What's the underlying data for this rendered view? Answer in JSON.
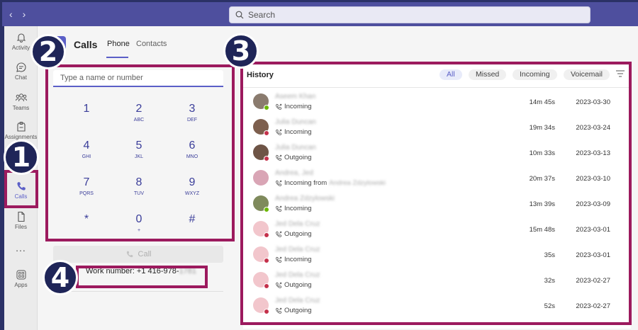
{
  "titlebar": {
    "search_placeholder": "Search"
  },
  "rail": {
    "items": [
      {
        "label": "Activity",
        "icon": "bell-icon"
      },
      {
        "label": "Chat",
        "icon": "chat-icon"
      },
      {
        "label": "Teams",
        "icon": "teams-icon"
      },
      {
        "label": "Assignments",
        "icon": "assignments-icon"
      },
      {
        "label": "Calls",
        "icon": "phone-icon"
      },
      {
        "label": "Files",
        "icon": "file-icon"
      },
      {
        "label": "...",
        "icon": "more-icon"
      },
      {
        "label": "Apps",
        "icon": "apps-icon"
      }
    ]
  },
  "header": {
    "title": "Calls",
    "tabs": [
      "Phone",
      "Contacts"
    ]
  },
  "dialpad": {
    "placeholder": "Type a name or number",
    "keys": [
      {
        "d": "1",
        "l": ""
      },
      {
        "d": "2",
        "l": "ABC"
      },
      {
        "d": "3",
        "l": "DEF"
      },
      {
        "d": "4",
        "l": "GHI"
      },
      {
        "d": "5",
        "l": "JKL"
      },
      {
        "d": "6",
        "l": "MNO"
      },
      {
        "d": "7",
        "l": "PQRS"
      },
      {
        "d": "8",
        "l": "TUV"
      },
      {
        "d": "9",
        "l": "WXYZ"
      },
      {
        "d": "*",
        "l": ""
      },
      {
        "d": "0",
        "l": "+"
      },
      {
        "d": "#",
        "l": ""
      }
    ],
    "call_label": "Call",
    "work_number_label": "Work number: +1 416-978-",
    "work_number_suffix": "1781"
  },
  "history": {
    "title": "History",
    "filters": [
      "All",
      "Missed",
      "Incoming",
      "Voicemail"
    ],
    "active_filter": "All",
    "rows": [
      {
        "name": "Aseem Khan",
        "direction": "Incoming",
        "extra": "",
        "duration": "14m 45s",
        "date": "2023-03-30",
        "presence": "#6bb700"
      },
      {
        "name": "Julia Duncan",
        "direction": "Incoming",
        "extra": "",
        "duration": "19m 34s",
        "date": "2023-03-24",
        "presence": "#c4314b"
      },
      {
        "name": "Julia Duncan",
        "direction": "Outgoing",
        "extra": "",
        "duration": "10m 33s",
        "date": "2023-03-13",
        "presence": "#c4314b"
      },
      {
        "name": "Andrea, Jed",
        "direction": "Incoming from",
        "extra": "Andrea Zdzylowski",
        "duration": "20m 37s",
        "date": "2023-03-10",
        "presence": ""
      },
      {
        "name": "Andrea Zdzylowski",
        "direction": "Incoming",
        "extra": "",
        "duration": "13m 39s",
        "date": "2023-03-09",
        "presence": "#6bb700"
      },
      {
        "name": "Jed Dela Cruz",
        "direction": "Outgoing",
        "extra": "",
        "duration": "15m 48s",
        "date": "2023-03-01",
        "presence": "#c4314b"
      },
      {
        "name": "Jed Dela Cruz",
        "direction": "Incoming",
        "extra": "",
        "duration": "35s",
        "date": "2023-03-01",
        "presence": "#c4314b"
      },
      {
        "name": "Jed Dela Cruz",
        "direction": "Outgoing",
        "extra": "",
        "duration": "32s",
        "date": "2023-02-27",
        "presence": "#c4314b"
      },
      {
        "name": "Jed Dela Cruz",
        "direction": "Outgoing",
        "extra": "",
        "duration": "52s",
        "date": "2023-02-27",
        "presence": "#c4314b"
      }
    ]
  },
  "annotations": [
    "1",
    "2",
    "3",
    "4"
  ],
  "colors": {
    "highlight": "#9c1a5e",
    "badge": "#1f2558",
    "accent": "#5b5fc7"
  }
}
